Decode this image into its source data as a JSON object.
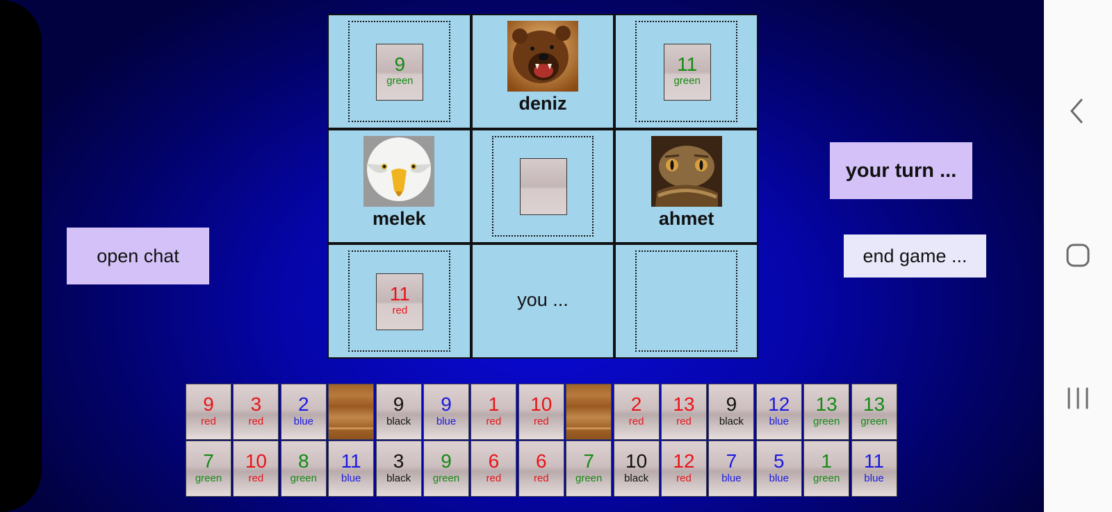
{
  "colors": {
    "red": "#e8141a",
    "green": "#148a14",
    "blue": "#1a1ae0",
    "black": "#111111"
  },
  "players": {
    "top": {
      "name": "deniz",
      "avatar": "bear-icon"
    },
    "left": {
      "name": "melek",
      "avatar": "eagle-icon"
    },
    "right": {
      "name": "ahmet",
      "avatar": "snake-icon"
    },
    "bottom": {
      "label": "you ..."
    }
  },
  "discards": {
    "top_left": {
      "number": "9",
      "color": "green"
    },
    "top_right": {
      "number": "11",
      "color": "green"
    },
    "bottom_left": {
      "number": "11",
      "color": "red"
    }
  },
  "buttons": {
    "open_chat": "open chat",
    "your_turn": "your turn ...",
    "end_game": "end game ..."
  },
  "rack": {
    "row1": [
      {
        "number": "9",
        "color": "red"
      },
      {
        "number": "3",
        "color": "red"
      },
      {
        "number": "2",
        "color": "blue"
      },
      {
        "empty": true
      },
      {
        "number": "9",
        "color": "black"
      },
      {
        "number": "9",
        "color": "blue"
      },
      {
        "number": "1",
        "color": "red"
      },
      {
        "number": "10",
        "color": "red"
      },
      {
        "empty": true
      },
      {
        "number": "2",
        "color": "red"
      },
      {
        "number": "13",
        "color": "red"
      },
      {
        "number": "9",
        "color": "black"
      },
      {
        "number": "12",
        "color": "blue"
      },
      {
        "number": "13",
        "color": "green"
      },
      {
        "number": "13",
        "color": "green"
      }
    ],
    "row2": [
      {
        "number": "7",
        "color": "green"
      },
      {
        "number": "10",
        "color": "red"
      },
      {
        "number": "8",
        "color": "green"
      },
      {
        "number": "11",
        "color": "blue"
      },
      {
        "number": "3",
        "color": "black"
      },
      {
        "number": "9",
        "color": "green"
      },
      {
        "number": "6",
        "color": "red"
      },
      {
        "number": "6",
        "color": "red"
      },
      {
        "number": "7",
        "color": "green"
      },
      {
        "number": "10",
        "color": "black"
      },
      {
        "number": "12",
        "color": "red"
      },
      {
        "number": "7",
        "color": "blue"
      },
      {
        "number": "5",
        "color": "blue"
      },
      {
        "number": "1",
        "color": "green"
      },
      {
        "number": "11",
        "color": "blue"
      }
    ]
  }
}
